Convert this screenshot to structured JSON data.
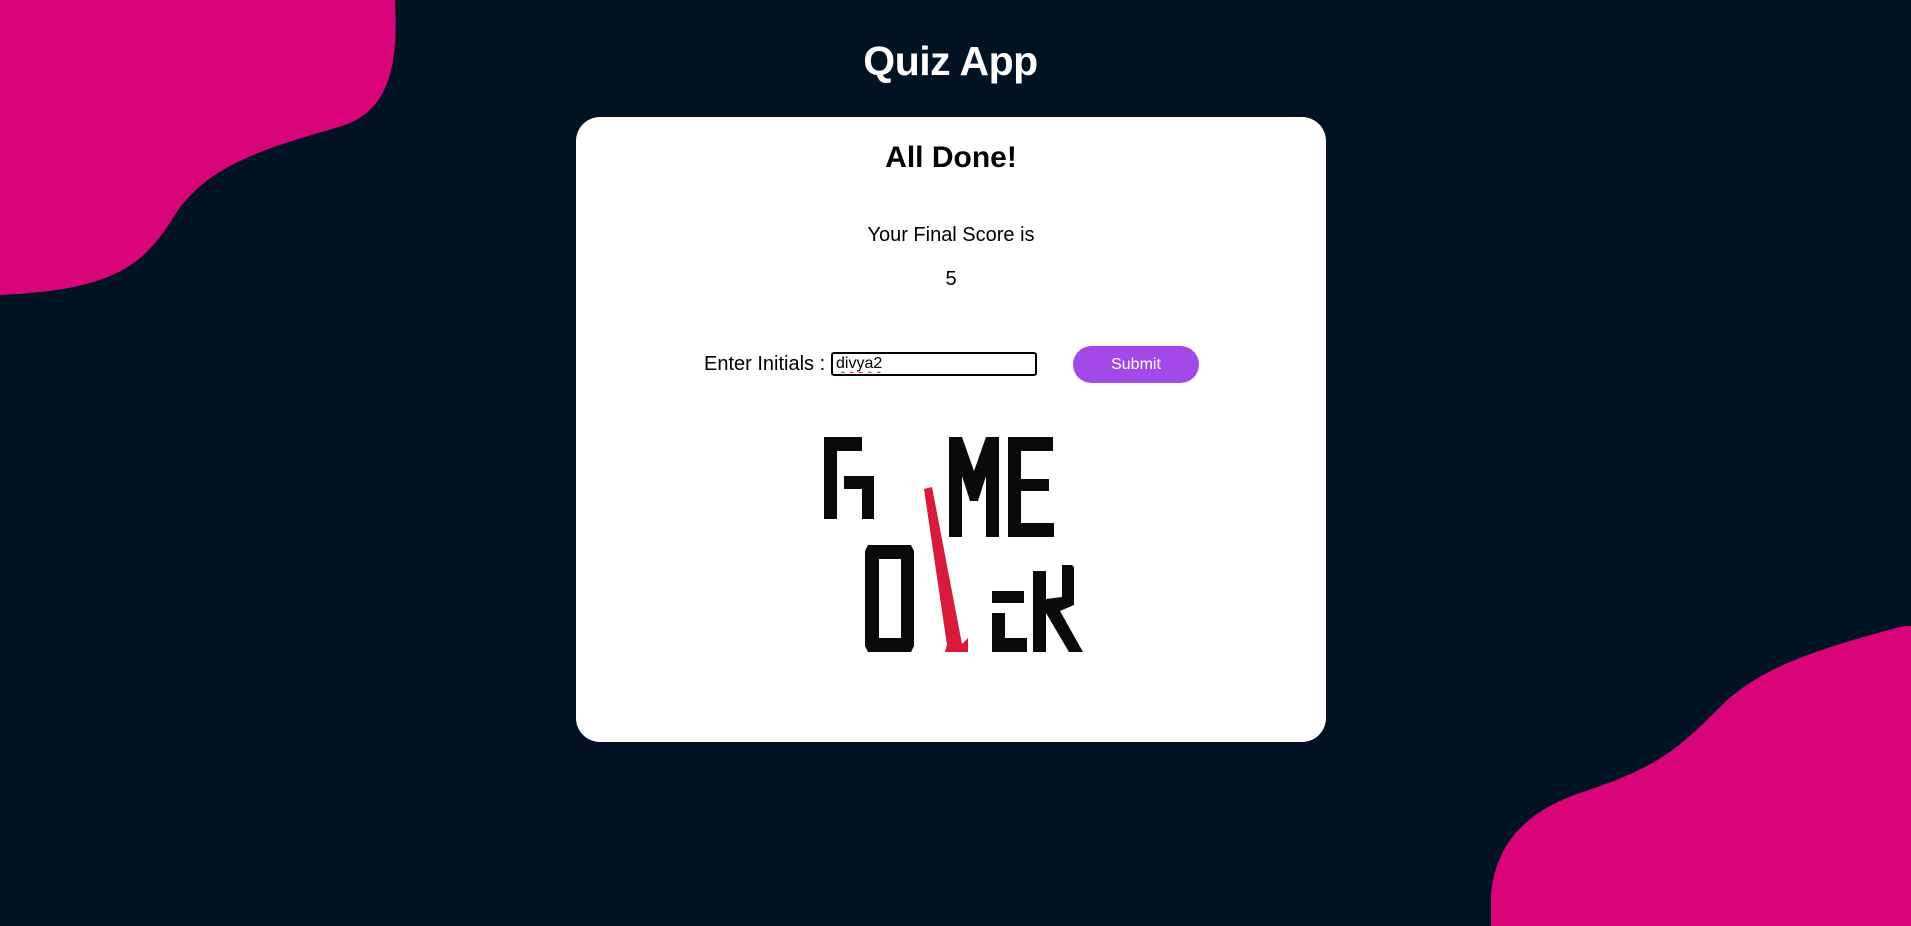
{
  "app": {
    "title": "Quiz App"
  },
  "result": {
    "heading": "All Done!",
    "score_label": "Your Final Score is",
    "score_value": "5"
  },
  "form": {
    "initials_label": "Enter Initials :",
    "initials_value": "divya2",
    "submit_label": "Submit"
  },
  "logo": {
    "text": "GAME OVER",
    "icon": "game-over-logo"
  },
  "colors": {
    "background": "#011222",
    "blob": "#d9037a",
    "card": "#ffffff",
    "accent_button": "#a449e9",
    "logo_dark": "#0a0a0a",
    "logo_red": "#d81b3a"
  }
}
